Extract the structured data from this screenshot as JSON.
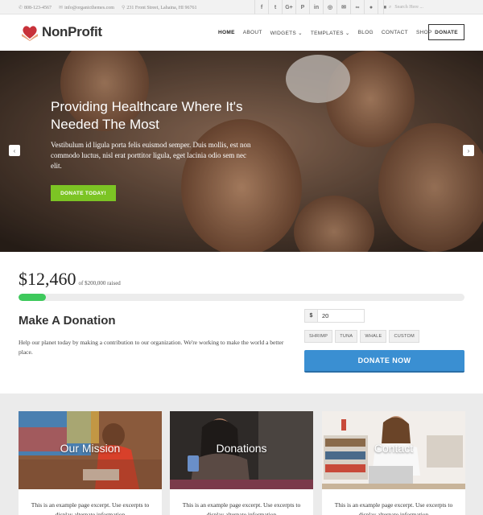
{
  "topbar": {
    "phone": "808-123-4567",
    "email": "info@organicthemes.com",
    "address": "231 Front Street, Lahaina, HI 96761",
    "social": [
      "f",
      "t",
      "G+",
      "P",
      "in",
      "◎",
      "✉",
      "∞",
      "●",
      "■"
    ],
    "search_placeholder": "Search Here ..."
  },
  "header": {
    "logo_text": "NonProfit",
    "nav": [
      "HOME",
      "ABOUT",
      "WIDGETS",
      "TEMPLATES",
      "BLOG",
      "CONTACT",
      "SHOP"
    ],
    "donate_label": "DONATE"
  },
  "hero": {
    "title": "Providing Healthcare Where It's Needed The Most",
    "description": "Vestibulum id ligula porta felis euismod semper. Duis mollis, est non commodo luctus, nisl erat porttitor ligula, eget lacinia odio sem nec elit.",
    "cta": "DONATE TODAY!",
    "prev": "‹",
    "next": "›"
  },
  "donation": {
    "raised": "$12,460",
    "goal_text": "of $200,000 raised",
    "progress_fraction": 0.062,
    "title": "Make A Donation",
    "description": "Help our planet today by making a contribution to our organization. We're working to make the world a better place.",
    "currency": "$",
    "amount": "20",
    "presets": [
      "SHRIMP",
      "TUNA",
      "WHALE",
      "CUSTOM"
    ],
    "button": "DONATE NOW"
  },
  "cards": [
    {
      "label": "Our Mission",
      "excerpt": "This is an example page excerpt. Use excerpts to display alternate information"
    },
    {
      "label": "Donations",
      "excerpt": "This is an example page excerpt. Use excerpts to display alternate information"
    },
    {
      "label": "Contact",
      "excerpt": "This is an example page excerpt. Use excerpts to display alternate information"
    }
  ],
  "colors": {
    "accent_green": "#7cc424",
    "progress_green": "#3ec95c",
    "donate_blue": "#3a8fd2"
  }
}
